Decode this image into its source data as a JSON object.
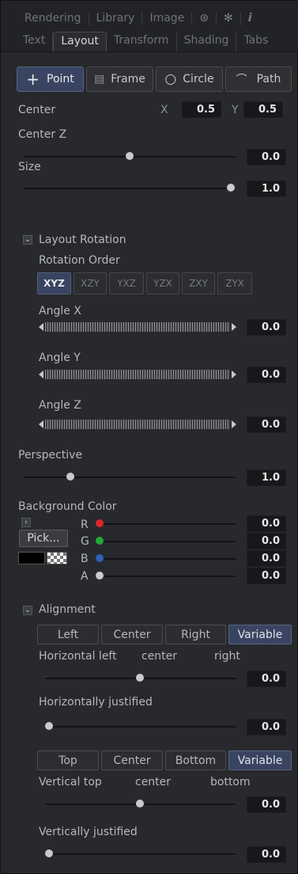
{
  "top_tabs": [
    "Rendering",
    "Library",
    "Image"
  ],
  "top_icons": [
    "settings-circle-icon",
    "gear-icon",
    "info-icon"
  ],
  "sub_tabs": [
    "Text",
    "Layout",
    "Transform",
    "Shading",
    "Tabs"
  ],
  "active_sub_tab": "Layout",
  "layout_type": {
    "buttons": [
      {
        "icon": "+",
        "label": "Point"
      },
      {
        "icon": "▤",
        "label": "Frame"
      },
      {
        "icon": "○",
        "label": "Circle"
      },
      {
        "icon": "⌒",
        "label": "Path"
      }
    ],
    "selected": "Point"
  },
  "center": {
    "label": "Center",
    "x_label": "X",
    "x_value": "0.5",
    "y_label": "Y",
    "y_value": "0.5"
  },
  "center_z": {
    "label": "Center Z",
    "value": "0.0",
    "level": 0.5
  },
  "size": {
    "label": "Size",
    "value": "1.0",
    "level": 1.0
  },
  "layout_rotation": {
    "header": "Layout Rotation",
    "expanded_glyph": "⌄",
    "rotation_order_label": "Rotation Order",
    "orders": [
      "XYZ",
      "XZY",
      "YXZ",
      "YZX",
      "ZXY",
      "ZYX"
    ],
    "selected_order": "XYZ",
    "angles": [
      {
        "label": "Angle X",
        "value": "0.0"
      },
      {
        "label": "Angle Y",
        "value": "0.0"
      },
      {
        "label": "Angle Z",
        "value": "0.0"
      }
    ]
  },
  "perspective": {
    "label": "Perspective",
    "value": "1.0",
    "level": 0.2
  },
  "background_color": {
    "label": "Background Color",
    "collapse_glyph": "›",
    "pick_label": "Pick...",
    "channels": [
      {
        "name": "R",
        "value": "0.0",
        "color": "#d9262b"
      },
      {
        "name": "G",
        "value": "0.0",
        "color": "#25a736"
      },
      {
        "name": "B",
        "value": "0.0",
        "color": "#2f5fb7"
      },
      {
        "name": "A",
        "value": "0.0",
        "color": "#c9cacd"
      }
    ]
  },
  "alignment": {
    "header": "Alignment",
    "expanded_glyph": "⌄",
    "horizontal_buttons": [
      "Left",
      "Center",
      "Right",
      "Variable"
    ],
    "horizontal_selected": "Variable",
    "horizontal_left_label": "Horizontal left",
    "horizontal_center_label": "center",
    "horizontal_right_label": "right",
    "horizontal_value": "0.0",
    "horizontal_level": 0.5,
    "horizontally_justified_label": "Horizontally justified",
    "horizontally_justified_value": "0.0",
    "horizontally_justified_level": 0.0,
    "vertical_buttons": [
      "Top",
      "Center",
      "Bottom",
      "Variable"
    ],
    "vertical_selected": "Variable",
    "vertical_top_label": "Vertical top",
    "vertical_center_label": "center",
    "vertical_bottom_label": "bottom",
    "vertical_value": "0.0",
    "vertical_level": 0.5,
    "vertically_justified_label": "Vertically justified",
    "vertically_justified_value": "0.0",
    "vertically_justified_level": 0.0
  }
}
